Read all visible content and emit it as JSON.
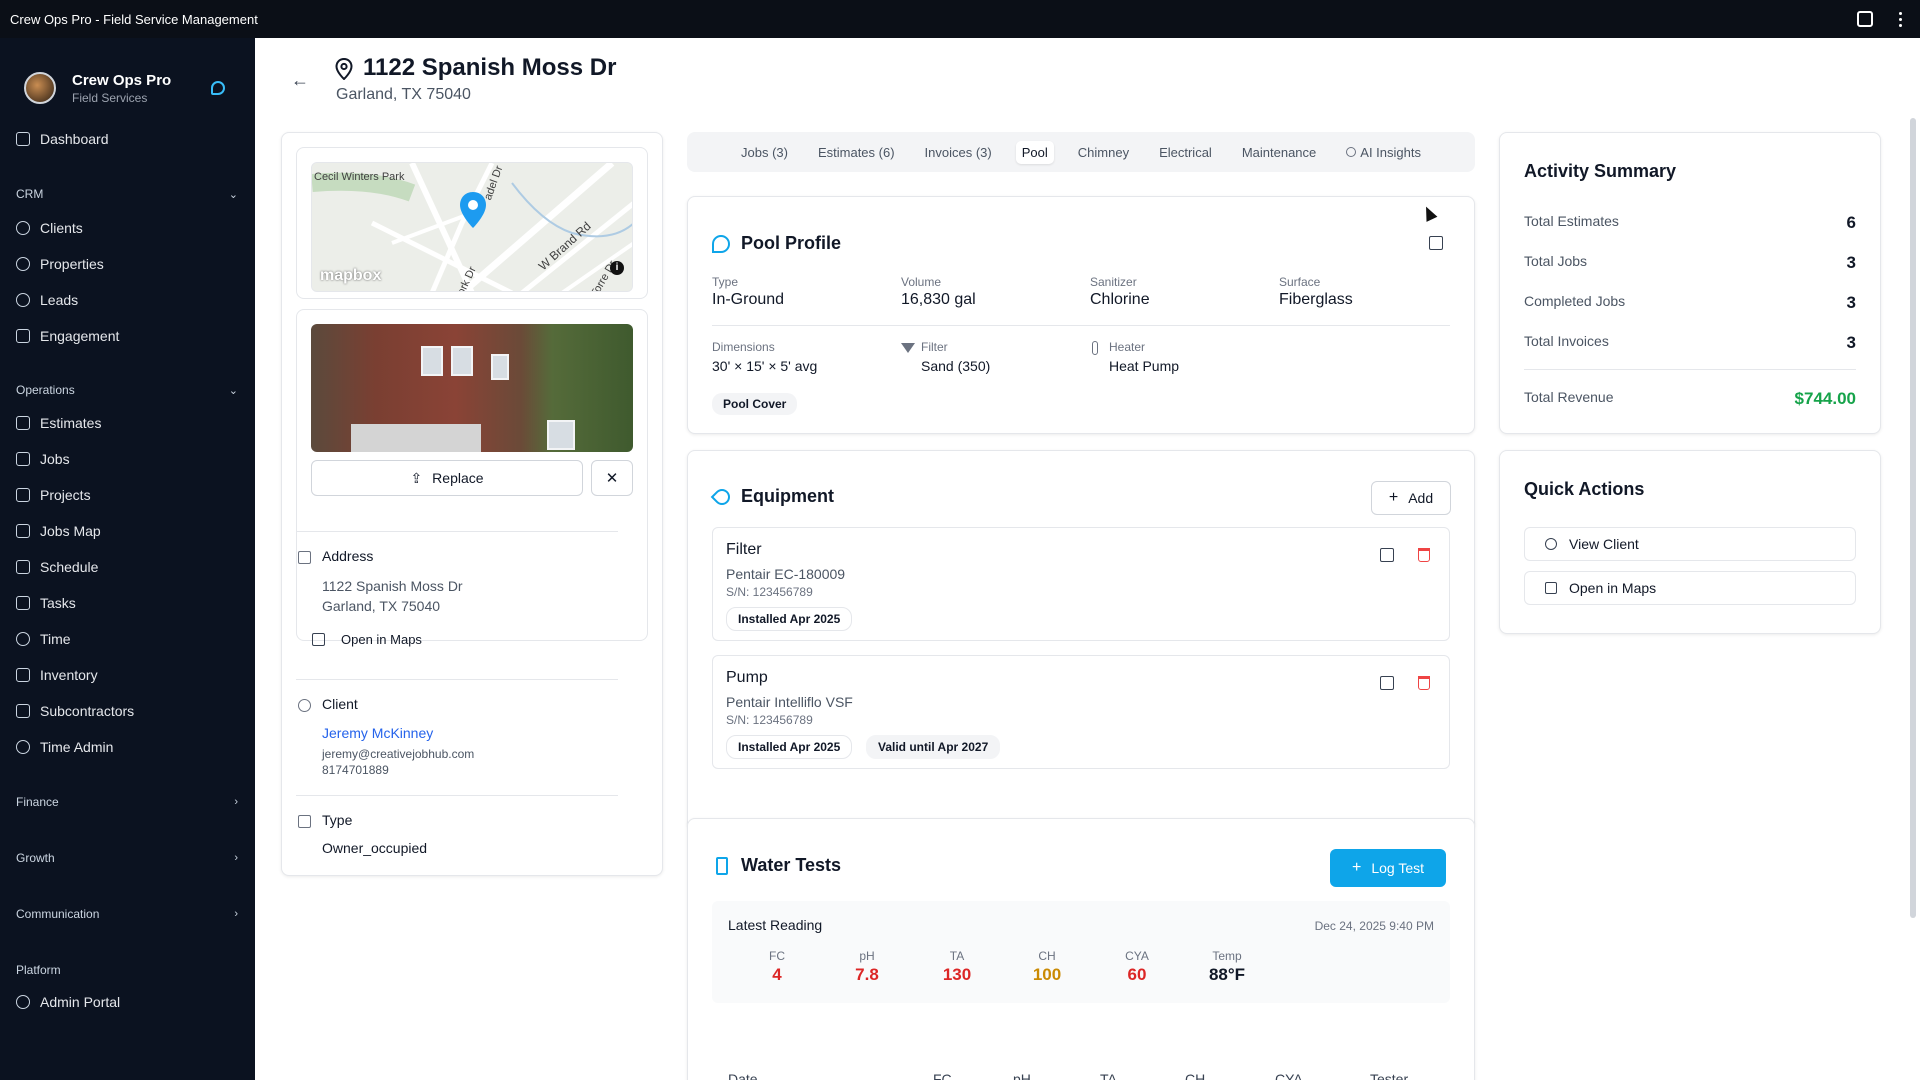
{
  "window": {
    "title": "Crew Ops Pro - Field Service Management"
  },
  "brand": {
    "name": "Crew Ops Pro",
    "subtitle": "Field Services"
  },
  "sidebar": {
    "dashboard": "Dashboard",
    "crm": {
      "label": "CRM",
      "items": [
        "Clients",
        "Properties",
        "Leads",
        "Engagement"
      ]
    },
    "operations": {
      "label": "Operations",
      "items": [
        "Estimates",
        "Jobs",
        "Projects",
        "Jobs Map",
        "Schedule",
        "Tasks",
        "Time",
        "Inventory",
        "Subcontractors",
        "Time Admin"
      ]
    },
    "finance": "Finance",
    "growth": "Growth",
    "communication": "Communication",
    "platform": {
      "label": "Platform",
      "items": [
        "Admin Portal"
      ]
    }
  },
  "header": {
    "title": "1122 Spanish Moss Dr",
    "subtitle": "Garland, TX 75040"
  },
  "map": {
    "labels": [
      "Cecil Winters Park",
      "W Brand Rd",
      "adel Dr",
      "ork Dr",
      "Torre Dr"
    ],
    "attribution": "mapbox"
  },
  "photo": {
    "replace_label": "Replace",
    "remove_label": "✕"
  },
  "address": {
    "label": "Address",
    "line1": "1122 Spanish Moss Dr",
    "line2": "Garland, TX 75040",
    "maps_link": "Open in Maps"
  },
  "client": {
    "label": "Client",
    "name": "Jeremy McKinney",
    "email": "jeremy@creativejobhub.com",
    "phone": "8174701889"
  },
  "type": {
    "label": "Type",
    "value": "Owner_occupied"
  },
  "tabs": [
    "Jobs (3)",
    "Estimates (6)",
    "Invoices (3)",
    "Pool",
    "Chimney",
    "Electrical",
    "Maintenance",
    "AI Insights"
  ],
  "pool_profile": {
    "title": "Pool Profile",
    "type": {
      "label": "Type",
      "value": "In-Ground"
    },
    "volume": {
      "label": "Volume",
      "value": "16,830 gal"
    },
    "sanitizer": {
      "label": "Sanitizer",
      "value": "Chlorine"
    },
    "surface": {
      "label": "Surface",
      "value": "Fiberglass"
    },
    "dimensions": {
      "label": "Dimensions",
      "value": "30' × 15' × 5' avg"
    },
    "filter": {
      "label": "Filter",
      "value": "Sand (350)"
    },
    "heater": {
      "label": "Heater",
      "value": "Heat Pump"
    },
    "chip": "Pool Cover"
  },
  "equipment": {
    "title": "Equipment",
    "add_label": "Add",
    "items": [
      {
        "name": "Filter",
        "model": "Pentair EC-180009",
        "serial": "S/N: 123456789",
        "installed": "Installed Apr 2025"
      },
      {
        "name": "Pump",
        "model": "Pentair Intelliflo VSF",
        "serial": "S/N: 123456789",
        "installed": "Installed Apr 2025",
        "warranty": "Valid until Apr 2027"
      }
    ]
  },
  "water_tests": {
    "title": "Water Tests",
    "log_label": "Log Test",
    "latest_label": "Latest Reading",
    "latest_date": "Dec 24, 2025 9:40 PM",
    "readings": [
      {
        "label": "FC",
        "value": "4",
        "color": "#dc2626"
      },
      {
        "label": "pH",
        "value": "7.8",
        "color": "#dc2626"
      },
      {
        "label": "TA",
        "value": "130",
        "color": "#dc2626"
      },
      {
        "label": "CH",
        "value": "100",
        "color": "#ca8a04"
      },
      {
        "label": "CYA",
        "value": "60",
        "color": "#dc2626"
      },
      {
        "label": "Temp",
        "value": "88°F",
        "color": "#111827"
      }
    ],
    "columns": [
      "Date",
      "FC",
      "pH",
      "TA",
      "CH",
      "CYA",
      "Tester"
    ]
  },
  "activity": {
    "title": "Activity Summary",
    "rows": [
      {
        "label": "Total Estimates",
        "value": "6"
      },
      {
        "label": "Total Jobs",
        "value": "3"
      },
      {
        "label": "Completed Jobs",
        "value": "3"
      },
      {
        "label": "Total Invoices",
        "value": "3"
      }
    ],
    "revenue_label": "Total Revenue",
    "revenue_value": "$744.00",
    "revenue_color": "#16a34a"
  },
  "quick_actions": {
    "title": "Quick Actions",
    "view_client": "View Client",
    "open_maps": "Open in Maps"
  }
}
